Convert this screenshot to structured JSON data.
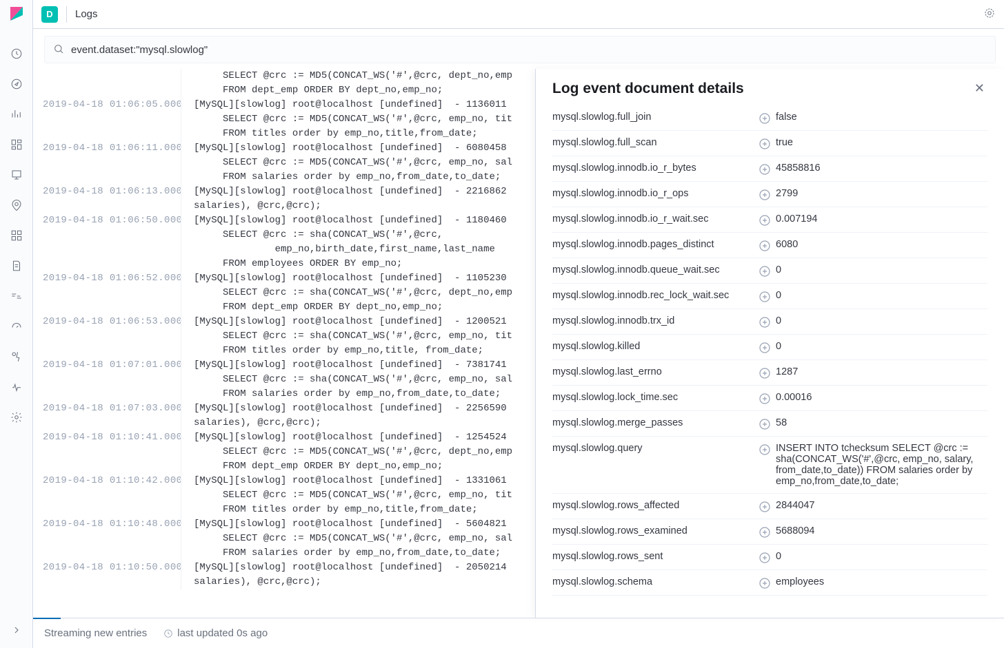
{
  "header": {
    "space_letter": "D",
    "breadcrumb": "Logs"
  },
  "search": {
    "value": "event.dataset:\"mysql.slowlog\""
  },
  "logs": [
    {
      "ts": "",
      "msg": "     SELECT @crc := MD5(CONCAT_WS('#',@crc, dept_no,emp\n     FROM dept_emp ORDER BY dept_no,emp_no;"
    },
    {
      "ts": "2019-04-18 01:06:05.000",
      "msg": "[MySQL][slowlog] root@localhost [undefined]  - 1136011\n     SELECT @crc := MD5(CONCAT_WS('#',@crc, emp_no, tit\n     FROM titles order by emp_no,title,from_date;"
    },
    {
      "ts": "2019-04-18 01:06:11.000",
      "msg": "[MySQL][slowlog] root@localhost [undefined]  - 6080458\n     SELECT @crc := MD5(CONCAT_WS('#',@crc, emp_no, sal\n     FROM salaries order by emp_no,from_date,to_date;"
    },
    {
      "ts": "2019-04-18 01:06:13.000",
      "msg": "[MySQL][slowlog] root@localhost [undefined]  - 2216862\nsalaries), @crc,@crc);"
    },
    {
      "ts": "2019-04-18 01:06:50.000",
      "msg": "[MySQL][slowlog] root@localhost [undefined]  - 1180460\n     SELECT @crc := sha(CONCAT_WS('#',@crc,\n              emp_no,birth_date,first_name,last_name\n     FROM employees ORDER BY emp_no;"
    },
    {
      "ts": "2019-04-18 01:06:52.000",
      "msg": "[MySQL][slowlog] root@localhost [undefined]  - 1105230\n     SELECT @crc := sha(CONCAT_WS('#',@crc, dept_no,emp\n     FROM dept_emp ORDER BY dept_no,emp_no;"
    },
    {
      "ts": "2019-04-18 01:06:53.000",
      "msg": "[MySQL][slowlog] root@localhost [undefined]  - 1200521\n     SELECT @crc := sha(CONCAT_WS('#',@crc, emp_no, tit\n     FROM titles order by emp_no,title, from_date;"
    },
    {
      "ts": "2019-04-18 01:07:01.000",
      "msg": "[MySQL][slowlog] root@localhost [undefined]  - 7381741\n     SELECT @crc := sha(CONCAT_WS('#',@crc, emp_no, sal\n     FROM salaries order by emp_no,from_date,to_date;"
    },
    {
      "ts": "2019-04-18 01:07:03.000",
      "msg": "[MySQL][slowlog] root@localhost [undefined]  - 2256590\nsalaries), @crc,@crc);"
    },
    {
      "ts": "2019-04-18 01:10:41.000",
      "msg": "[MySQL][slowlog] root@localhost [undefined]  - 1254524\n     SELECT @crc := MD5(CONCAT_WS('#',@crc, dept_no,emp\n     FROM dept_emp ORDER BY dept_no,emp_no;"
    },
    {
      "ts": "2019-04-18 01:10:42.000",
      "msg": "[MySQL][slowlog] root@localhost [undefined]  - 1331061\n     SELECT @crc := MD5(CONCAT_WS('#',@crc, emp_no, tit\n     FROM titles order by emp_no,title,from_date;"
    },
    {
      "ts": "2019-04-18 01:10:48.000",
      "msg": "[MySQL][slowlog] root@localhost [undefined]  - 5604821\n     SELECT @crc := MD5(CONCAT_WS('#',@crc, emp_no, sal\n     FROM salaries order by emp_no,from_date,to_date;"
    },
    {
      "ts": "2019-04-18 01:10:50.000",
      "msg": "[MySQL][slowlog] root@localhost [undefined]  - 2050214\nsalaries), @crc,@crc);"
    }
  ],
  "statusbar": {
    "streaming": "Streaming new entries",
    "updated": "last updated 0s ago"
  },
  "flyout": {
    "title": "Log event document details",
    "rows": [
      {
        "key": "mysql.slowlog.full_join",
        "val": "false"
      },
      {
        "key": "mysql.slowlog.full_scan",
        "val": "true"
      },
      {
        "key": "mysql.slowlog.innodb.io_r_bytes",
        "val": "45858816"
      },
      {
        "key": "mysql.slowlog.innodb.io_r_ops",
        "val": "2799"
      },
      {
        "key": "mysql.slowlog.innodb.io_r_wait.sec",
        "val": "0.007194"
      },
      {
        "key": "mysql.slowlog.innodb.pages_distinct",
        "val": "6080"
      },
      {
        "key": "mysql.slowlog.innodb.queue_wait.sec",
        "val": "0"
      },
      {
        "key": "mysql.slowlog.innodb.rec_lock_wait.sec",
        "val": "0"
      },
      {
        "key": "mysql.slowlog.innodb.trx_id",
        "val": "0"
      },
      {
        "key": "mysql.slowlog.killed",
        "val": "0"
      },
      {
        "key": "mysql.slowlog.last_errno",
        "val": "1287"
      },
      {
        "key": "mysql.slowlog.lock_time.sec",
        "val": "0.00016"
      },
      {
        "key": "mysql.slowlog.merge_passes",
        "val": "58"
      },
      {
        "key": "mysql.slowlog.query",
        "val": "INSERT INTO tchecksum SELECT @crc := sha(CONCAT_WS('#',@crc, emp_no, salary, from_date,to_date)) FROM salaries order by emp_no,from_date,to_date;"
      },
      {
        "key": "mysql.slowlog.rows_affected",
        "val": "2844047"
      },
      {
        "key": "mysql.slowlog.rows_examined",
        "val": "5688094"
      },
      {
        "key": "mysql.slowlog.rows_sent",
        "val": "0"
      },
      {
        "key": "mysql.slowlog.schema",
        "val": "employees"
      }
    ]
  }
}
